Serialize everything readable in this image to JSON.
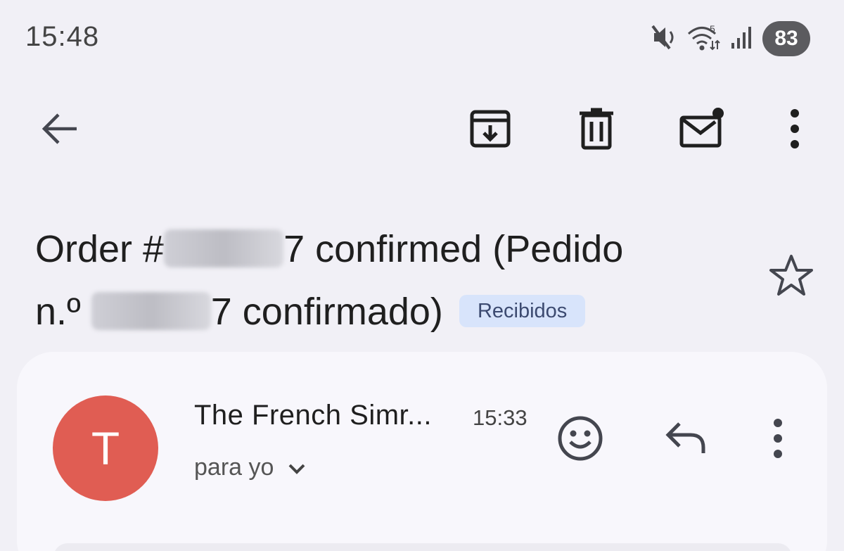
{
  "status_bar": {
    "time": "15:48",
    "battery_level": "83",
    "icons": [
      "mute-icon",
      "wifi-icon",
      "signal-icon",
      "battery-icon"
    ]
  },
  "toolbar": {
    "icons": [
      "back-arrow-icon",
      "archive-icon",
      "delete-icon",
      "mark-unread-icon",
      "more-vert-icon"
    ]
  },
  "subject": {
    "line1_before": "Order #",
    "line1_after": "7 confirmed (Pedido",
    "line2_before": "n.º ",
    "line2_after": "7 confirmado)",
    "label": "Recibidos"
  },
  "message": {
    "avatar_letter": "T",
    "avatar_color": "#e05d53",
    "sender": "The French Simr...",
    "time": "15:33",
    "recipient": "para yo",
    "icons": [
      "emoji-react-icon",
      "reply-icon",
      "more-vert-icon"
    ]
  },
  "colors": {
    "background": "#f1f0f6",
    "card": "#f8f7fc",
    "label_chip": "#d8e4fb"
  }
}
